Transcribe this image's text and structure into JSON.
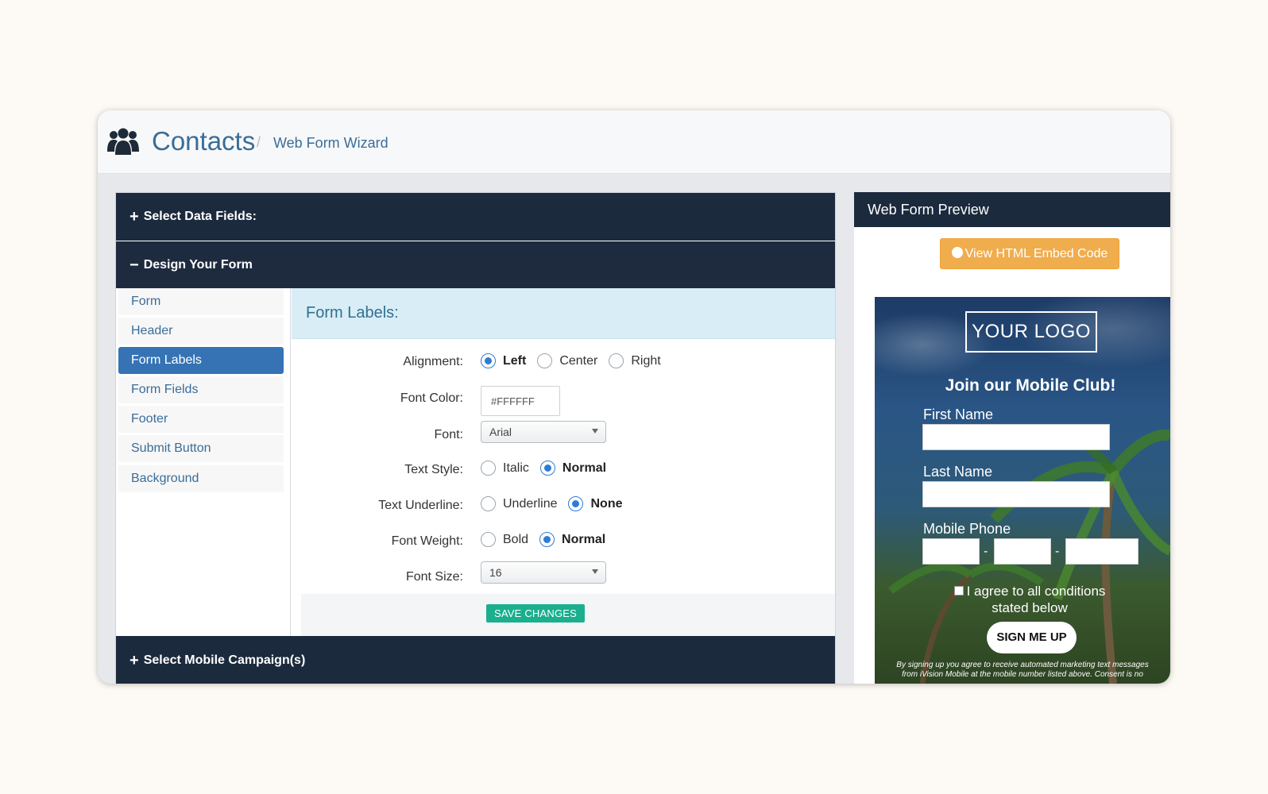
{
  "header": {
    "icon": "people-icon",
    "title": "Contacts",
    "separator": "/",
    "breadcrumb": "Web Form Wizard"
  },
  "accordion": {
    "select_data_fields": {
      "symbol": "+",
      "label": "Select Data Fields:"
    },
    "design_form": {
      "symbol": "−",
      "label": "Design Your Form"
    },
    "select_campaigns": {
      "symbol": "+",
      "label": "Select Mobile Campaign(s)"
    }
  },
  "nav": {
    "items": [
      {
        "label": "Form"
      },
      {
        "label": "Header"
      },
      {
        "label": "Form Labels"
      },
      {
        "label": "Form Fields"
      },
      {
        "label": "Footer"
      },
      {
        "label": "Submit Button"
      },
      {
        "label": "Background"
      }
    ],
    "active": "Form Labels"
  },
  "form_labels": {
    "heading": "Form Labels:",
    "alignment": {
      "label": "Alignment:",
      "options": [
        "Left",
        "Center",
        "Right"
      ],
      "selected": "Left"
    },
    "font_color": {
      "label": "Font Color:",
      "value": "#FFFFFF"
    },
    "font": {
      "label": "Font:",
      "value": "Arial"
    },
    "text_style": {
      "label": "Text Style:",
      "options": [
        "Italic",
        "Normal"
      ],
      "selected": "Normal"
    },
    "text_underline": {
      "label": "Text Underline:",
      "options": [
        "Underline",
        "None"
      ],
      "selected": "None"
    },
    "font_weight": {
      "label": "Font Weight:",
      "options": [
        "Bold",
        "Normal"
      ],
      "selected": "Normal"
    },
    "font_size": {
      "label": "Font Size:",
      "value": "16"
    },
    "save_label": "SAVE CHANGES"
  },
  "preview": {
    "title": "Web Form Preview",
    "embed_button": "View HTML Embed Code",
    "logo": "YOUR LOGO",
    "headline": "Join our Mobile Club!",
    "first_name": "First Name",
    "last_name": "Last Name",
    "mobile_phone": "Mobile Phone",
    "phone_sep": "-",
    "agree_text": "I agree to all conditions stated below",
    "signup": "SIGN ME UP",
    "disclaimer_line1": "By signing up you agree to receive automated marketing text messages",
    "disclaimer_line2": "from iVision Mobile at the mobile number listed above. Consent is no"
  },
  "colors": {
    "accent": "#3573b5",
    "dark_header": "#1c2a3e",
    "save": "#1aaf8e",
    "embed": "#f0ad4e",
    "radio": "#2f7cd4"
  }
}
